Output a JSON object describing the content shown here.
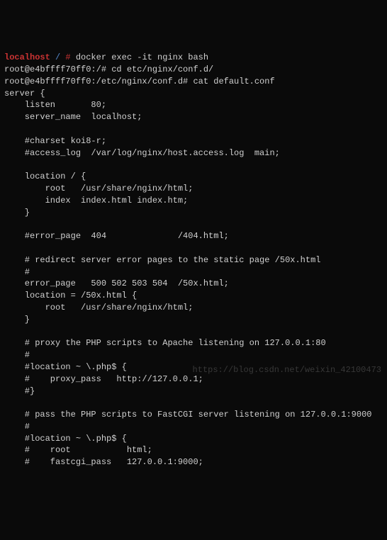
{
  "prompt1": {
    "host": "localhost",
    "sep1": " ",
    "path": "/",
    "sep2": " ",
    "symbol": "#",
    "cmd": " docker exec -it nginx bash"
  },
  "prompt2": {
    "full": "root@e4bffff70ff0:/# cd etc/nginx/conf.d/"
  },
  "prompt3": {
    "full": "root@e4bffff70ff0:/etc/nginx/conf.d# cat default.conf"
  },
  "conf": {
    "l1": "server {",
    "l2": "    listen       80;",
    "l3": "    server_name  localhost;",
    "l4": "",
    "l5": "    #charset koi8-r;",
    "l6": "    #access_log  /var/log/nginx/host.access.log  main;",
    "l7": "",
    "l8": "    location / {",
    "l9": "        root   /usr/share/nginx/html;",
    "l10": "        index  index.html index.htm;",
    "l11": "    }",
    "l12": "",
    "l13": "    #error_page  404              /404.html;",
    "l14": "",
    "l15": "    # redirect server error pages to the static page /50x.html",
    "l16": "    #",
    "l17": "    error_page   500 502 503 504  /50x.html;",
    "l18": "    location = /50x.html {",
    "l19": "        root   /usr/share/nginx/html;",
    "l20": "    }",
    "l21": "",
    "l22": "    # proxy the PHP scripts to Apache listening on 127.0.0.1:80",
    "l23": "    #",
    "l24": "    #location ~ \\.php$ {",
    "l25": "    #    proxy_pass   http://127.0.0.1;",
    "l26": "    #}",
    "l27": "",
    "l28": "    # pass the PHP scripts to FastCGI server listening on 127.0.0.1:9000",
    "l29": "    #",
    "l30": "    #location ~ \\.php$ {",
    "l31": "    #    root           html;",
    "l32": "    #    fastcgi_pass   127.0.0.1:9000;"
  },
  "watermark": "https://blog.csdn.net/weixin_42100473"
}
